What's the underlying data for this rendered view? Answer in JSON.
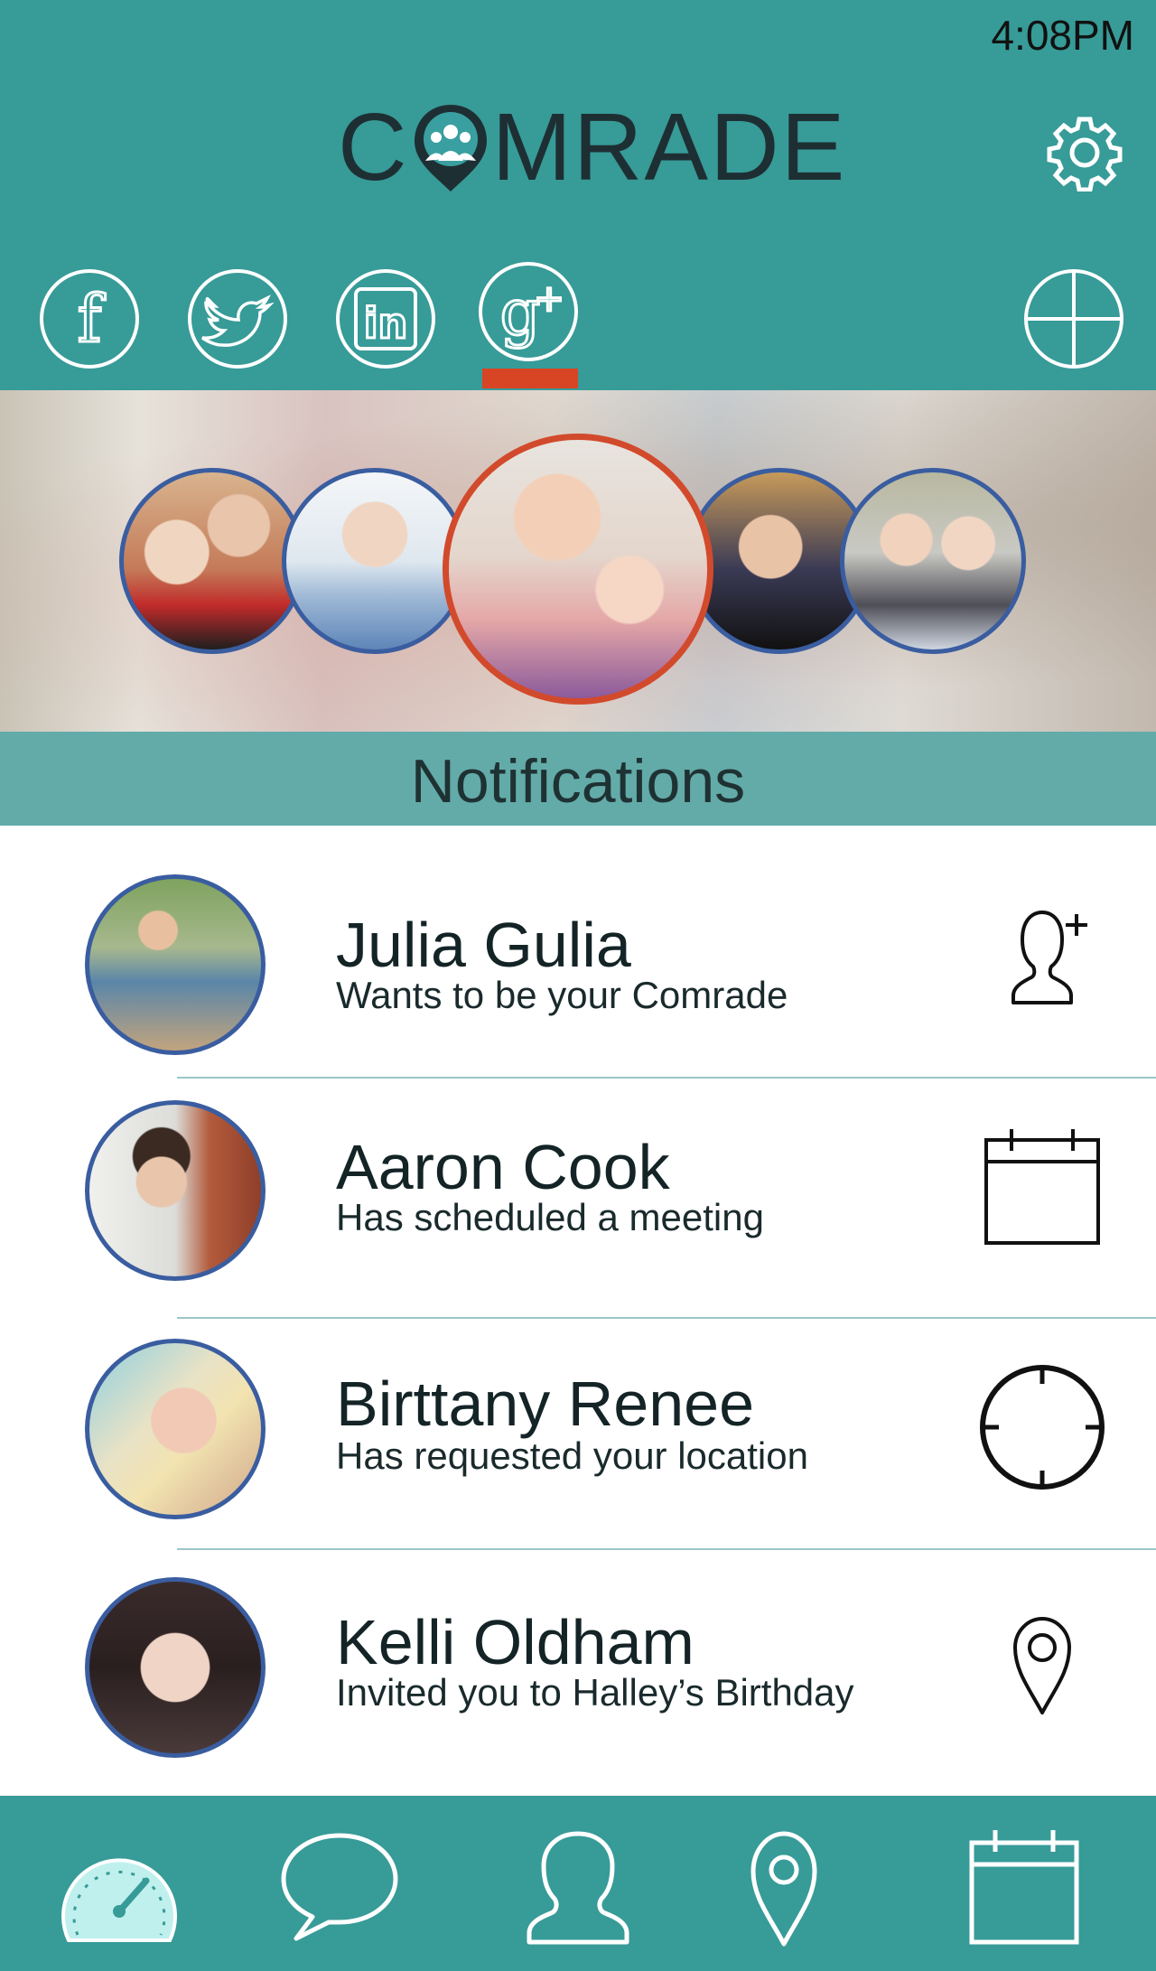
{
  "status_bar": {
    "time": "4:08PM"
  },
  "app": {
    "logo_text_left": "C",
    "logo_text_right": "MRADE"
  },
  "social_tabs": [
    {
      "name": "facebook",
      "glyph": "f",
      "active": false
    },
    {
      "name": "twitter",
      "glyph": "bird",
      "active": false
    },
    {
      "name": "linkedin",
      "glyph": "in",
      "active": false
    },
    {
      "name": "google-plus",
      "glyph": "g+",
      "active": true
    }
  ],
  "section": {
    "title": "Notifications"
  },
  "notifications": [
    {
      "name": "Julia Gulia",
      "message": "Wants to be your Comrade",
      "icon": "add-user-icon"
    },
    {
      "name": "Aaron Cook",
      "message": "Has scheduled a meeting",
      "icon": "calendar-icon"
    },
    {
      "name": "Birttany  Renee",
      "message": "Has requested your location",
      "icon": "crosshair-icon"
    },
    {
      "name": "Kelli Oldham",
      "message": "Invited you to Halley’s Birthday",
      "icon": "map-pin-icon"
    }
  ],
  "bottom_nav": [
    {
      "name": "dashboard",
      "icon": "speedometer-icon",
      "active": true
    },
    {
      "name": "messages",
      "icon": "chat-bubble-icon",
      "active": false
    },
    {
      "name": "contacts",
      "icon": "person-icon",
      "active": false
    },
    {
      "name": "locations",
      "icon": "map-pin-icon",
      "active": false
    },
    {
      "name": "calendar",
      "icon": "calendar-icon",
      "active": false
    }
  ],
  "colors": {
    "header": "#379b98",
    "accent_active": "#d84524",
    "avatar_border": "#3a5da0",
    "notif_bar": "#63aba8",
    "nav_active": "#bff0ee"
  }
}
